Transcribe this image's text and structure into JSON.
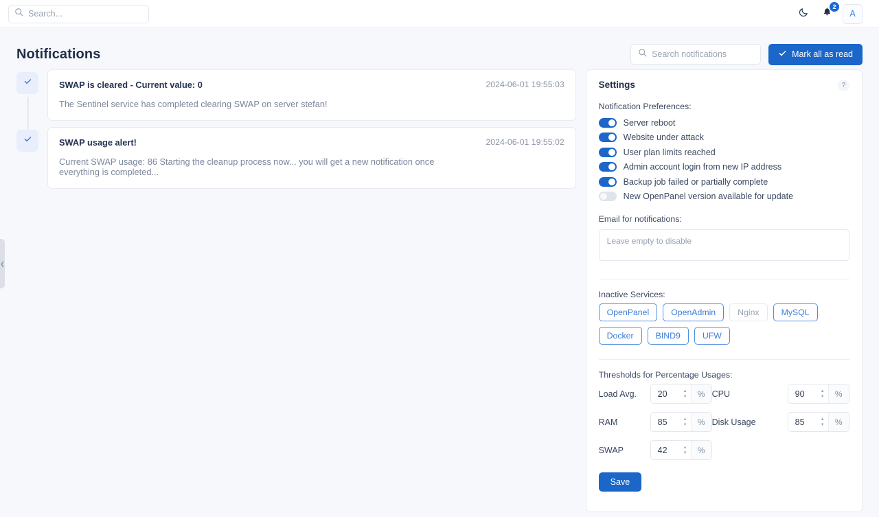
{
  "topbar": {
    "search_placeholder": "Search...",
    "theme_icon": "moon-icon",
    "bell_icon": "bell-icon",
    "notification_count": "2",
    "avatar_initial": "A"
  },
  "header": {
    "title": "Notifications",
    "search_placeholder": "Search notifications",
    "mark_all_label": "Mark all as read"
  },
  "notifications": [
    {
      "title": "SWAP is cleared - Current value: 0",
      "text": "The Sentinel service has completed clearing SWAP on server stefan!",
      "time": "2024-06-01 19:55:03"
    },
    {
      "title": "SWAP usage alert!",
      "text": "Current SWAP usage: 86 Starting the cleanup process now... you will get a new notification once everything is completed...",
      "time": "2024-06-01 19:55:02"
    }
  ],
  "settings": {
    "title": "Settings",
    "help_label": "?",
    "preferences_label": "Notification Preferences:",
    "preferences": [
      {
        "label": "Server reboot",
        "enabled": true
      },
      {
        "label": "Website under attack",
        "enabled": true
      },
      {
        "label": "User plan limits reached",
        "enabled": true
      },
      {
        "label": "Admin account login from new IP address",
        "enabled": true
      },
      {
        "label": "Backup job failed or partially complete",
        "enabled": true
      },
      {
        "label": "New OpenPanel version available for update",
        "enabled": false
      }
    ],
    "email_label": "Email for notifications:",
    "email_placeholder": "Leave empty to disable",
    "email_value": "",
    "services_label": "Inactive Services:",
    "services": [
      {
        "label": "OpenPanel",
        "selected": true
      },
      {
        "label": "OpenAdmin",
        "selected": true
      },
      {
        "label": "Nginx",
        "selected": false
      },
      {
        "label": "MySQL",
        "selected": true
      },
      {
        "label": "Docker",
        "selected": true
      },
      {
        "label": "BIND9",
        "selected": true
      },
      {
        "label": "UFW",
        "selected": true
      }
    ],
    "thresholds_label": "Thresholds for Percentage Usages:",
    "thresholds": [
      {
        "label": "Load Avg.",
        "value": "20",
        "unit": "%"
      },
      {
        "label": "CPU",
        "value": "90",
        "unit": "%"
      },
      {
        "label": "RAM",
        "value": "85",
        "unit": "%"
      },
      {
        "label": "Disk Usage",
        "value": "85",
        "unit": "%"
      },
      {
        "label": "SWAP",
        "value": "42",
        "unit": "%"
      }
    ],
    "save_label": "Save"
  },
  "colors": {
    "accent": "#1a66c9",
    "link": "#3b7ddd",
    "page_bg": "#f6f8fb"
  }
}
